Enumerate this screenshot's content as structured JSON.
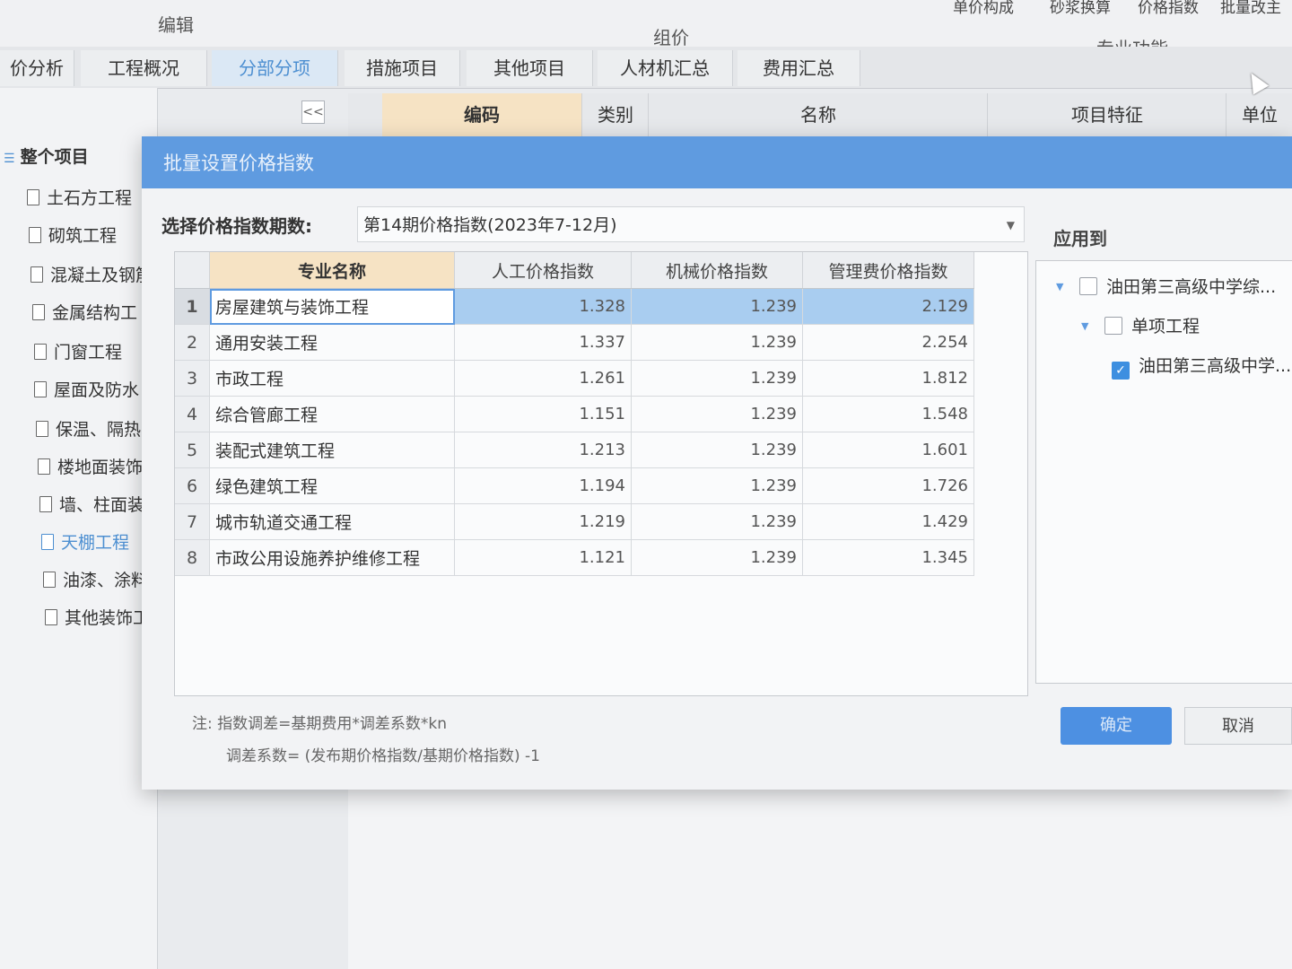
{
  "ribbon": {
    "group_edit": "编辑",
    "group_pricing": "组价",
    "group_special": "专业功能",
    "tools": [
      "单价构成",
      "砂浆换算",
      "价格指数",
      "批量改主"
    ]
  },
  "tabs": [
    {
      "label": "价分析"
    },
    {
      "label": "工程概况"
    },
    {
      "label": "分部分项"
    },
    {
      "label": "措施项目"
    },
    {
      "label": "其他项目"
    },
    {
      "label": "人材机汇总"
    },
    {
      "label": "费用汇总"
    }
  ],
  "tree": {
    "collapse_label": "<<",
    "root": "整个项目",
    "items": [
      "土石方工程",
      "砌筑工程",
      "混凝土及钢筋",
      "金属结构工",
      "门窗工程",
      "屋面及防水",
      "保温、隔热",
      "楼地面装饰",
      "墙、柱面装",
      "天棚工程",
      "油漆、涂料",
      "其他装饰工"
    ]
  },
  "grid_header": {
    "columns": [
      "编码",
      "类别",
      "名称",
      "项目特征",
      "单位"
    ]
  },
  "dialog": {
    "title": "批量设置价格指数",
    "period_label": "选择价格指数期数:",
    "period_value": "第14期价格指数(2023年7-12月)",
    "columns": [
      "专业名称",
      "人工价格指数",
      "机械价格指数",
      "管理费价格指数"
    ],
    "rows": [
      {
        "idx": "1",
        "name": "房屋建筑与装饰工程",
        "labor": "1.328",
        "machine": "1.239",
        "mgmt": "2.129"
      },
      {
        "idx": "2",
        "name": "通用安装工程",
        "labor": "1.337",
        "machine": "1.239",
        "mgmt": "2.254"
      },
      {
        "idx": "3",
        "name": "市政工程",
        "labor": "1.261",
        "machine": "1.239",
        "mgmt": "1.812"
      },
      {
        "idx": "4",
        "name": "综合管廊工程",
        "labor": "1.151",
        "machine": "1.239",
        "mgmt": "1.548"
      },
      {
        "idx": "5",
        "name": "装配式建筑工程",
        "labor": "1.213",
        "machine": "1.239",
        "mgmt": "1.601"
      },
      {
        "idx": "6",
        "name": "绿色建筑工程",
        "labor": "1.194",
        "machine": "1.239",
        "mgmt": "1.726"
      },
      {
        "idx": "7",
        "name": "城市轨道交通工程",
        "labor": "1.219",
        "machine": "1.239",
        "mgmt": "1.429"
      },
      {
        "idx": "8",
        "name": "市政公用设施养护维修工程",
        "labor": "1.121",
        "machine": "1.239",
        "mgmt": "1.345"
      }
    ],
    "note_line1": "注: 指数调差=基期费用*调差系数*kn",
    "note_line2": "调差系数= (发布期价格指数/基期价格指数) -1",
    "apply_label": "应用到",
    "apply_tree": [
      {
        "label": "油田第三高级中学综...",
        "checked": false
      },
      {
        "label": "单项工程",
        "checked": false
      },
      {
        "label": "油田第三高级中学...",
        "checked": true
      }
    ],
    "ok_label": "确定",
    "cancel_label": "取消"
  }
}
